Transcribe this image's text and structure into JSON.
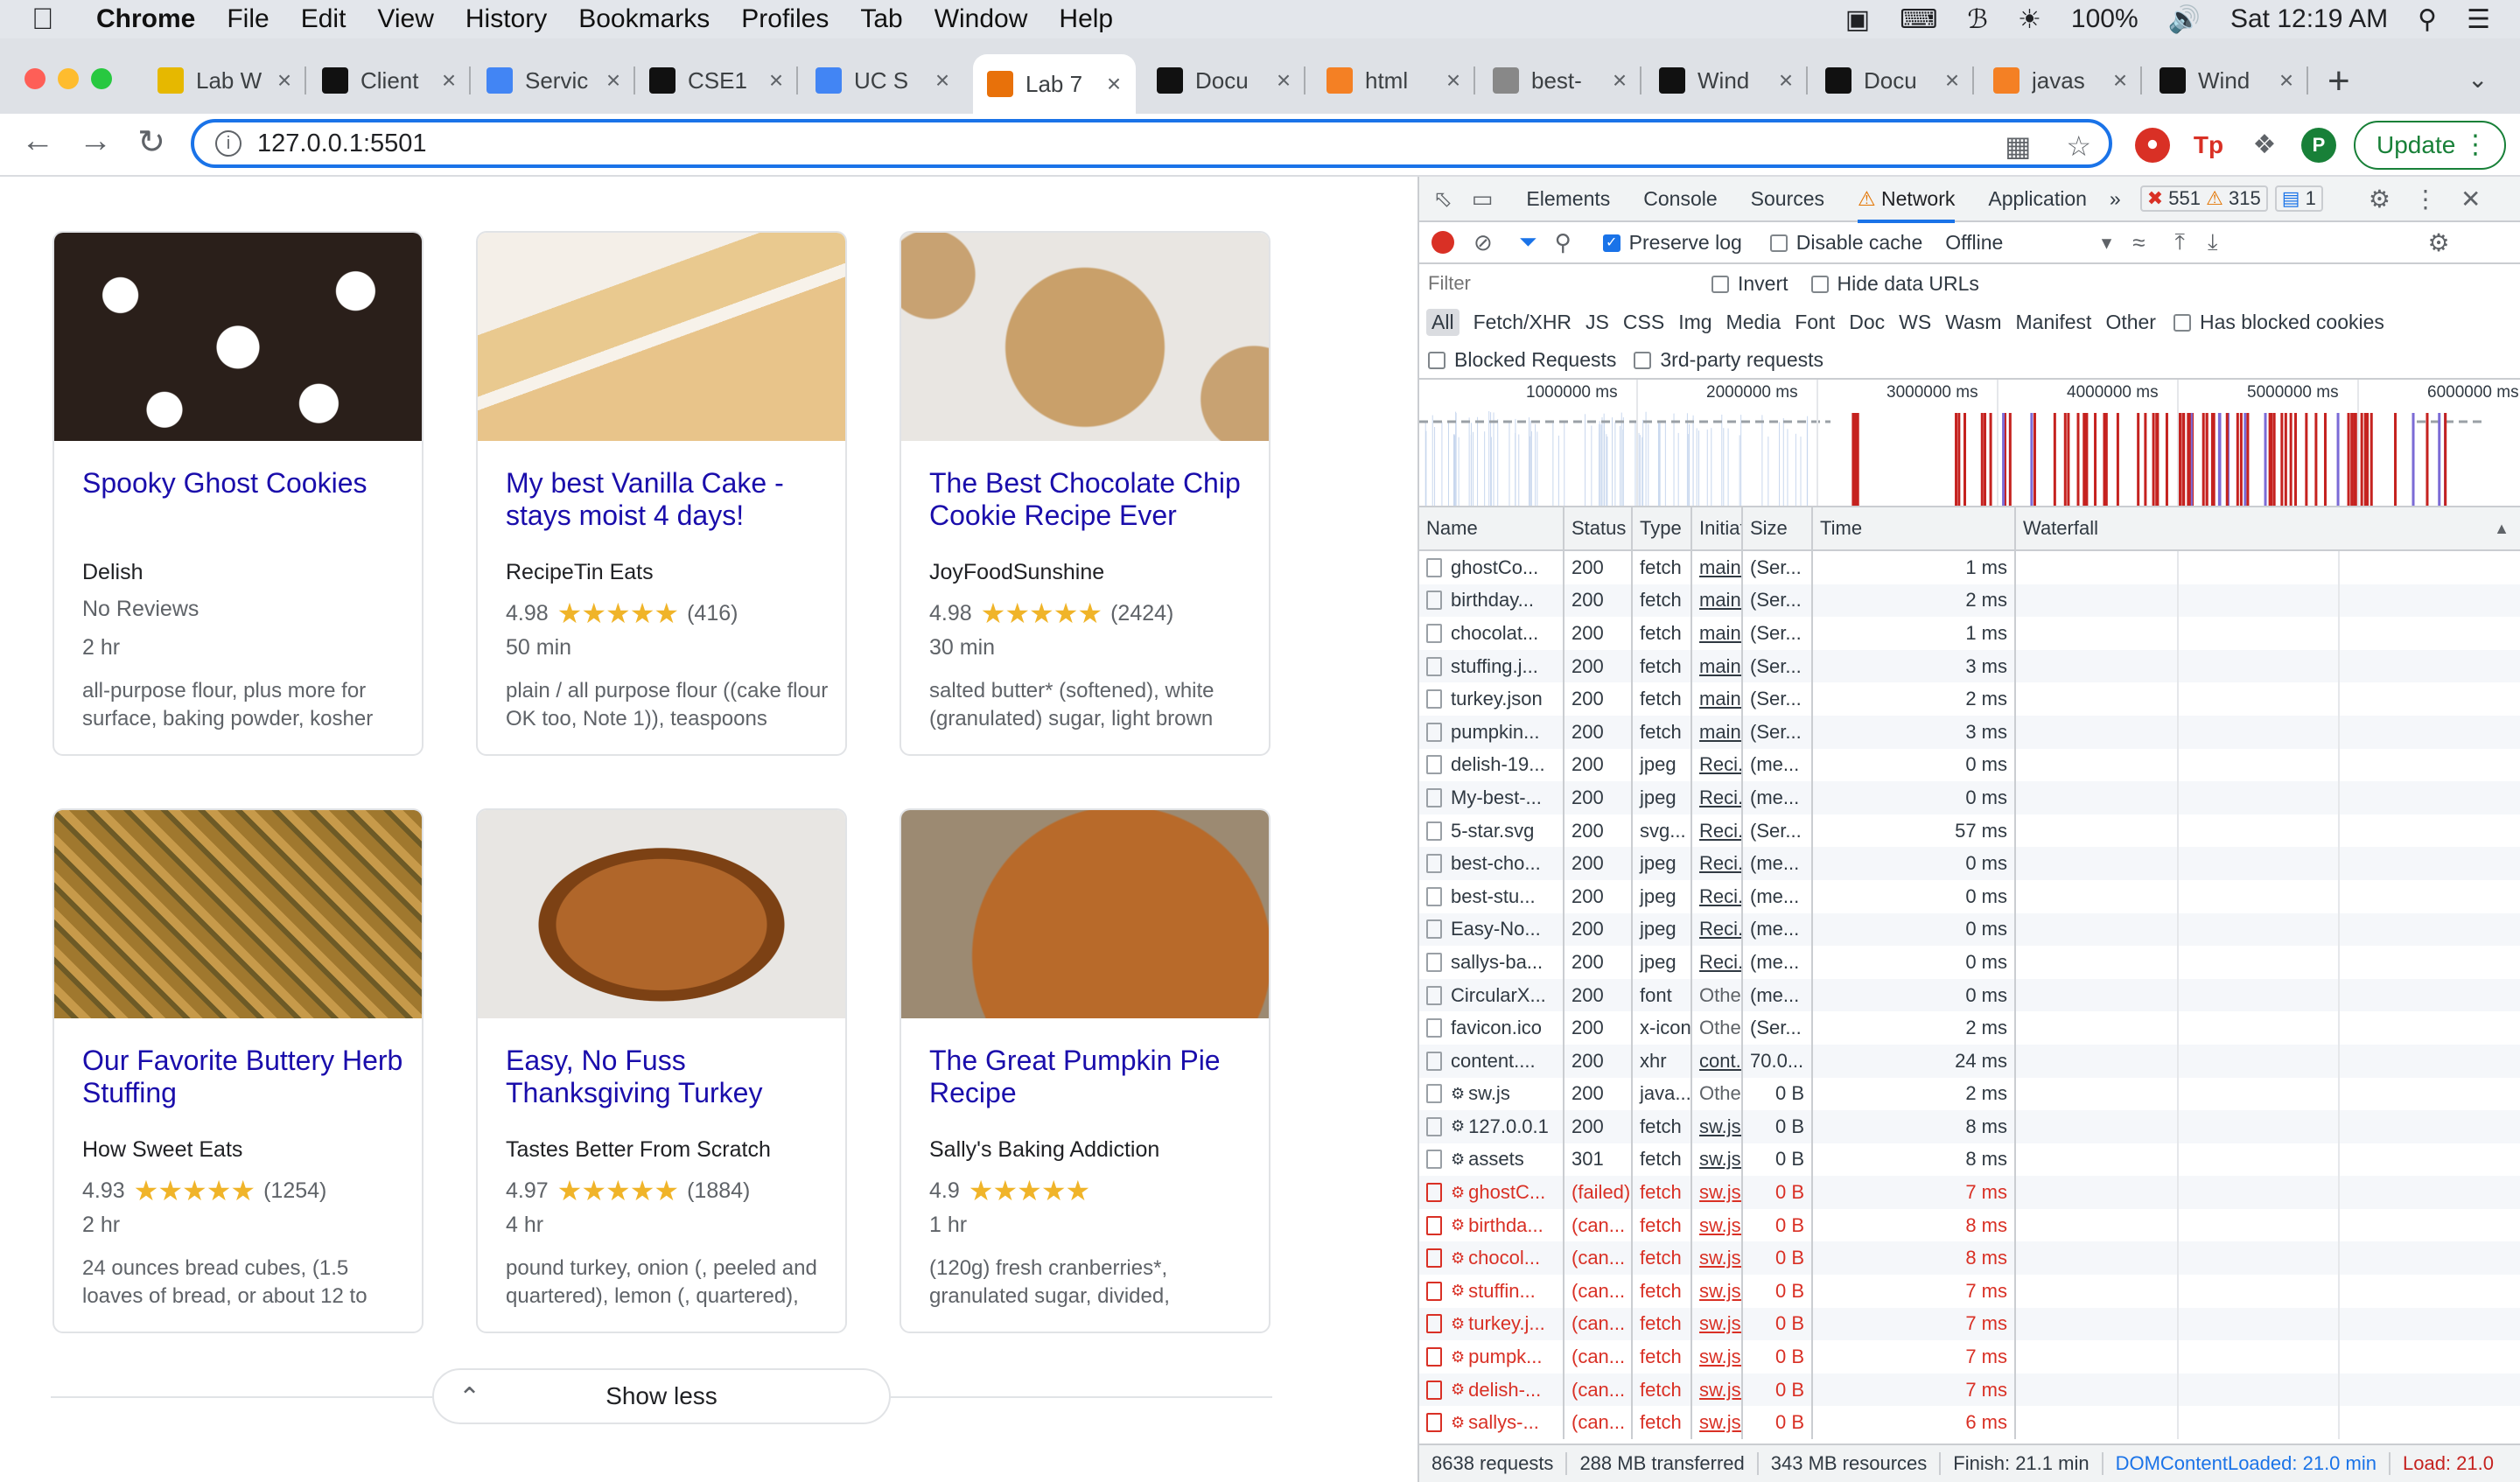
{
  "macmenu": {
    "app": "Chrome",
    "items": [
      "File",
      "Edit",
      "View",
      "History",
      "Bookmarks",
      "Profiles",
      "Tab",
      "Window",
      "Help"
    ],
    "battery": "100%",
    "clock": "Sat 12:19 AM"
  },
  "tabs": [
    {
      "label": "Lab W",
      "color": "#e6b800"
    },
    {
      "label": "Client",
      "color": "#111111"
    },
    {
      "label": "Servic",
      "color": "#4285f4"
    },
    {
      "label": "CSE1",
      "color": "#111111"
    },
    {
      "label": "UC S",
      "color": "#4285f4"
    },
    {
      "label": "Lab 7",
      "color": "#e8710a"
    },
    {
      "label": "Docu",
      "color": "#111111"
    },
    {
      "label": "html",
      "color": "#f48024"
    },
    {
      "label": "best-",
      "color": "#888888"
    },
    {
      "label": "Wind",
      "color": "#111111"
    },
    {
      "label": "Docu",
      "color": "#111111"
    },
    {
      "label": "javas",
      "color": "#f48024"
    },
    {
      "label": "Wind",
      "color": "#111111"
    }
  ],
  "address": {
    "url": "127.0.0.1:5501",
    "update_label": "Update",
    "profile_initial": "P"
  },
  "recipes": [
    {
      "title": "Spooky Ghost Cookies",
      "source": "Delish",
      "rating": "",
      "stars": "",
      "count": "No Reviews",
      "time": "2 hr",
      "ingredients": "all-purpose flour, plus more for surface, baking powder, kosher",
      "img": "ghost"
    },
    {
      "title": "My best Vanilla Cake - stays moist 4 days!",
      "source": "RecipeTin Eats",
      "rating": "4.98",
      "stars": "★★★★★",
      "count": "(416)",
      "time": "50 min",
      "ingredients": "plain / all purpose flour ((cake flour OK too, Note 1)), teaspoons",
      "img": "cake"
    },
    {
      "title": "The Best Chocolate Chip Cookie Recipe Ever",
      "source": "JoyFoodSunshine",
      "rating": "4.98",
      "stars": "★★★★★",
      "count": "(2424)",
      "time": "30 min",
      "ingredients": "salted butter* (softened), white (granulated) sugar, light brown",
      "img": "cookie"
    },
    {
      "title": "Our Favorite Buttery Herb Stuffing",
      "source": "How Sweet Eats",
      "rating": "4.93",
      "stars": "★★★★★",
      "count": "(1254)",
      "time": "2 hr",
      "ingredients": "24 ounces bread cubes, (1.5 loaves of bread, or about 12 to",
      "img": "stuffing"
    },
    {
      "title": "Easy, No Fuss Thanksgiving Turkey",
      "source": "Tastes Better From Scratch",
      "rating": "4.97",
      "stars": "★★★★★",
      "count": "(1884)",
      "time": "4 hr",
      "ingredients": "pound turkey, onion (, peeled and quartered), lemon (, quartered),",
      "img": "turkey"
    },
    {
      "title": "The Great Pumpkin Pie Recipe",
      "source": "Sally's Baking Addiction",
      "rating": "4.9",
      "stars": "★★★★★",
      "count": "",
      "time": "1 hr",
      "ingredients": "(120g) fresh cranberries*, granulated sugar, divided,",
      "img": "pie"
    }
  ],
  "show_less": "Show less",
  "devtools": {
    "tabs": [
      "Elements",
      "Console",
      "Sources",
      "Network",
      "Application"
    ],
    "active": "Network",
    "errors": "551",
    "warnings": "315",
    "messages": "1",
    "preserve_log": "Preserve log",
    "disable_cache": "Disable cache",
    "throttle": "Offline",
    "filter_placeholder": "Filter",
    "invert": "Invert",
    "hide_data": "Hide data URLs",
    "types": [
      "All",
      "Fetch/XHR",
      "JS",
      "CSS",
      "Img",
      "Media",
      "Font",
      "Doc",
      "WS",
      "Wasm",
      "Manifest",
      "Other"
    ],
    "has_blocked": "Has blocked cookies",
    "blocked_requests": "Blocked Requests",
    "third_party": "3rd-party requests",
    "timeline_ticks": [
      "1000000 ms",
      "2000000 ms",
      "3000000 ms",
      "4000000 ms",
      "5000000 ms",
      "6000000 ms"
    ],
    "columns": [
      "Name",
      "Status",
      "Type",
      "Initiator",
      "Size",
      "Time",
      "Waterfall"
    ],
    "requests": [
      {
        "name": "ghostCo...",
        "status": "200",
        "type": "fetch",
        "initiator": "main....",
        "size": "(Ser...",
        "time": "1 ms",
        "err": false,
        "sw": false
      },
      {
        "name": "birthday...",
        "status": "200",
        "type": "fetch",
        "initiator": "main....",
        "size": "(Ser...",
        "time": "2 ms",
        "err": false,
        "sw": false
      },
      {
        "name": "chocolat...",
        "status": "200",
        "type": "fetch",
        "initiator": "main....",
        "size": "(Ser...",
        "time": "1 ms",
        "err": false,
        "sw": false
      },
      {
        "name": "stuffing.j...",
        "status": "200",
        "type": "fetch",
        "initiator": "main....",
        "size": "(Ser...",
        "time": "3 ms",
        "err": false,
        "sw": false
      },
      {
        "name": "turkey.json",
        "status": "200",
        "type": "fetch",
        "initiator": "main....",
        "size": "(Ser...",
        "time": "2 ms",
        "err": false,
        "sw": false
      },
      {
        "name": "pumpkin...",
        "status": "200",
        "type": "fetch",
        "initiator": "main....",
        "size": "(Ser...",
        "time": "3 ms",
        "err": false,
        "sw": false
      },
      {
        "name": "delish-19...",
        "status": "200",
        "type": "jpeg",
        "initiator": "Reci...",
        "size": "(me...",
        "time": "0 ms",
        "err": false,
        "sw": false
      },
      {
        "name": "My-best-...",
        "status": "200",
        "type": "jpeg",
        "initiator": "Reci...",
        "size": "(me...",
        "time": "0 ms",
        "err": false,
        "sw": false
      },
      {
        "name": "5-star.svg",
        "status": "200",
        "type": "svg...",
        "initiator": "Reci...",
        "size": "(Ser...",
        "time": "57 ms",
        "err": false,
        "sw": false
      },
      {
        "name": "best-cho...",
        "status": "200",
        "type": "jpeg",
        "initiator": "Reci...",
        "size": "(me...",
        "time": "0 ms",
        "err": false,
        "sw": false
      },
      {
        "name": "best-stu...",
        "status": "200",
        "type": "jpeg",
        "initiator": "Reci...",
        "size": "(me...",
        "time": "0 ms",
        "err": false,
        "sw": false
      },
      {
        "name": "Easy-No...",
        "status": "200",
        "type": "jpeg",
        "initiator": "Reci...",
        "size": "(me...",
        "time": "0 ms",
        "err": false,
        "sw": false
      },
      {
        "name": "sallys-ba...",
        "status": "200",
        "type": "jpeg",
        "initiator": "Reci...",
        "size": "(me...",
        "time": "0 ms",
        "err": false,
        "sw": false
      },
      {
        "name": "CircularX...",
        "status": "200",
        "type": "font",
        "initiator": "Other",
        "size": "(me...",
        "time": "0 ms",
        "err": false,
        "sw": false
      },
      {
        "name": "favicon.ico",
        "status": "200",
        "type": "x-icon",
        "initiator": "Other",
        "size": "(Ser...",
        "time": "2 ms",
        "err": false,
        "sw": false
      },
      {
        "name": "content....",
        "status": "200",
        "type": "xhr",
        "initiator": "cont...",
        "size": "70.0...",
        "time": "24 ms",
        "err": false,
        "sw": false
      },
      {
        "name": "sw.js",
        "status": "200",
        "type": "java...",
        "initiator": "Other",
        "size": "0 B",
        "time": "2 ms",
        "err": false,
        "sw": true
      },
      {
        "name": "127.0.0.1",
        "status": "200",
        "type": "fetch",
        "initiator": "sw.js...",
        "size": "0 B",
        "time": "8 ms",
        "err": false,
        "sw": true
      },
      {
        "name": "assets",
        "status": "301",
        "type": "fetch",
        "initiator": "sw.js...",
        "size": "0 B",
        "time": "8 ms",
        "err": false,
        "sw": true
      },
      {
        "name": "ghostC...",
        "status": "(failed)",
        "type": "fetch",
        "initiator": "sw.js...",
        "size": "0 B",
        "time": "7 ms",
        "err": true,
        "sw": true
      },
      {
        "name": "birthda...",
        "status": "(can...",
        "type": "fetch",
        "initiator": "sw.js...",
        "size": "0 B",
        "time": "8 ms",
        "err": true,
        "sw": true
      },
      {
        "name": "chocol...",
        "status": "(can...",
        "type": "fetch",
        "initiator": "sw.js...",
        "size": "0 B",
        "time": "8 ms",
        "err": true,
        "sw": true
      },
      {
        "name": "stuffin...",
        "status": "(can...",
        "type": "fetch",
        "initiator": "sw.js...",
        "size": "0 B",
        "time": "7 ms",
        "err": true,
        "sw": true
      },
      {
        "name": "turkey.j...",
        "status": "(can...",
        "type": "fetch",
        "initiator": "sw.js...",
        "size": "0 B",
        "time": "7 ms",
        "err": true,
        "sw": true
      },
      {
        "name": "pumpk...",
        "status": "(can...",
        "type": "fetch",
        "initiator": "sw.js...",
        "size": "0 B",
        "time": "7 ms",
        "err": true,
        "sw": true
      },
      {
        "name": "delish-...",
        "status": "(can...",
        "type": "fetch",
        "initiator": "sw.js...",
        "size": "0 B",
        "time": "7 ms",
        "err": true,
        "sw": true
      },
      {
        "name": "sallys-...",
        "status": "(can...",
        "type": "fetch",
        "initiator": "sw.js...",
        "size": "0 B",
        "time": "6 ms",
        "err": true,
        "sw": true
      }
    ],
    "status": {
      "requests": "8638 requests",
      "transferred": "288 MB transferred",
      "resources": "343 MB resources",
      "finish": "Finish: 21.1 min",
      "dcl": "DOMContentLoaded: 21.0 min",
      "load": "Load: 21.0"
    }
  }
}
